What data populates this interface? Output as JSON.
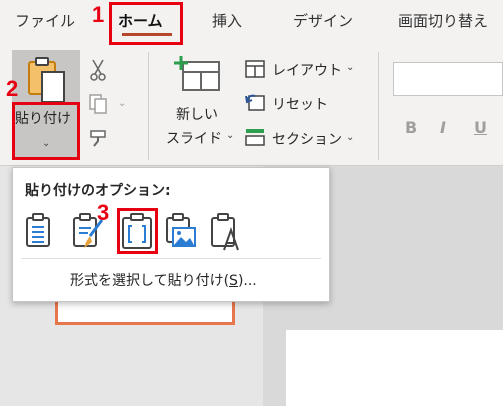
{
  "tabs": [
    {
      "label": "ファイル"
    },
    {
      "label": "ホーム"
    },
    {
      "label": "挿入"
    },
    {
      "label": "デザイン"
    },
    {
      "label": "画面切り替え"
    }
  ],
  "ribbon": {
    "paste_label": "貼り付け",
    "new_slide_line1": "新しい",
    "new_slide_line2": "スライド",
    "layout_label": "レイアウト",
    "reset_label": "リセット",
    "section_label": "セクション",
    "bold_label": "B",
    "italic_label": "I",
    "underline_label": "U"
  },
  "paste_menu": {
    "title": "貼り付けのオプション:",
    "options": [
      {
        "icon": "paste-use-destination-theme-icon"
      },
      {
        "icon": "paste-keep-source-formatting-icon"
      },
      {
        "icon": "paste-picture-frame-icon"
      },
      {
        "icon": "paste-as-picture-icon"
      },
      {
        "icon": "paste-keep-text-only-icon"
      }
    ],
    "special_prefix": "形式を選択して貼り付け(",
    "special_key": "S",
    "special_suffix": ")..."
  },
  "annotations": {
    "step1": "1",
    "step2": "2",
    "step3": "3"
  },
  "colors": {
    "accent": "#b7472a",
    "annotation": "#e60012",
    "thumb_border": "#e8764c"
  }
}
